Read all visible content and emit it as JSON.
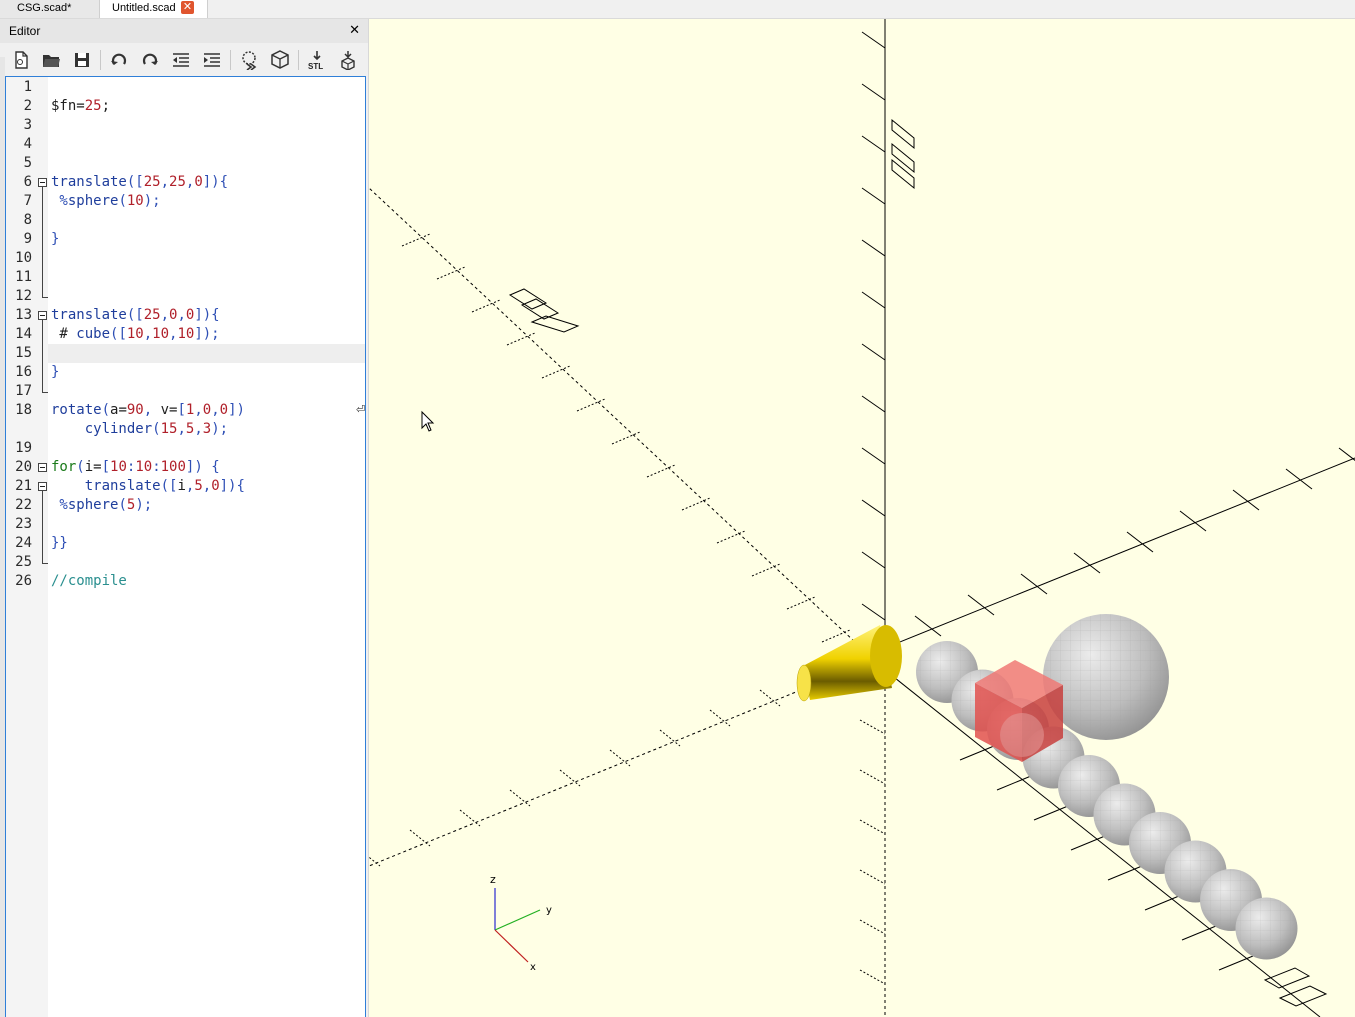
{
  "tabs": [
    {
      "label": "CSG.scad*",
      "active": false
    },
    {
      "label": "Untitled.scad",
      "active": true,
      "close_glyph": "✕"
    }
  ],
  "editor": {
    "title": "Editor",
    "close_glyph": "✕",
    "toolbar": [
      {
        "name": "new-file-icon"
      },
      {
        "name": "open-file-icon"
      },
      {
        "name": "save-icon"
      },
      {
        "name": "undo-icon"
      },
      {
        "name": "redo-icon"
      },
      {
        "name": "unindent-icon"
      },
      {
        "name": "indent-icon"
      },
      {
        "name": "preview-icon"
      },
      {
        "name": "render-icon"
      },
      {
        "name": "export-stl-icon",
        "label": "STL"
      },
      {
        "name": "send-to-3d-print-icon"
      }
    ],
    "wrap_glyph": "⏎",
    "lines": [
      {
        "n": "1",
        "tokens": []
      },
      {
        "n": "2",
        "tokens": [
          [
            "$fn=",
            "plain"
          ],
          [
            "25",
            "num"
          ],
          [
            ";",
            "plain"
          ]
        ]
      },
      {
        "n": "3",
        "tokens": []
      },
      {
        "n": "4",
        "tokens": []
      },
      {
        "n": "5",
        "tokens": []
      },
      {
        "n": "6",
        "tokens": [
          [
            "translate",
            "kw"
          ],
          [
            "([",
            "op"
          ],
          [
            "25",
            "num"
          ],
          [
            ",",
            "op"
          ],
          [
            "25",
            "num"
          ],
          [
            ",",
            "op"
          ],
          [
            "0",
            "num"
          ],
          [
            "]){",
            "op"
          ]
        ]
      },
      {
        "n": "7",
        "tokens": [
          [
            " %",
            "op"
          ],
          [
            "sphere",
            "kw"
          ],
          [
            "(",
            "op"
          ],
          [
            "10",
            "num"
          ],
          [
            ");",
            "op"
          ]
        ]
      },
      {
        "n": "8",
        "tokens": []
      },
      {
        "n": "9",
        "tokens": [
          [
            "}",
            "op"
          ]
        ]
      },
      {
        "n": "10",
        "tokens": []
      },
      {
        "n": "11",
        "tokens": []
      },
      {
        "n": "12",
        "tokens": []
      },
      {
        "n": "13",
        "tokens": [
          [
            "translate",
            "kw"
          ],
          [
            "([",
            "op"
          ],
          [
            "25",
            "num"
          ],
          [
            ",",
            "op"
          ],
          [
            "0",
            "num"
          ],
          [
            ",",
            "op"
          ],
          [
            "0",
            "num"
          ],
          [
            "]){",
            "op"
          ]
        ]
      },
      {
        "n": "14",
        "tokens": [
          [
            " # ",
            "plain"
          ],
          [
            "cube",
            "kw"
          ],
          [
            "([",
            "op"
          ],
          [
            "10",
            "num"
          ],
          [
            ",",
            "op"
          ],
          [
            "10",
            "num"
          ],
          [
            ",",
            "op"
          ],
          [
            "10",
            "num"
          ],
          [
            "]);",
            "op"
          ]
        ]
      },
      {
        "n": "15",
        "tokens": []
      },
      {
        "n": "16",
        "tokens": [
          [
            "}",
            "op"
          ]
        ]
      },
      {
        "n": "17",
        "tokens": []
      },
      {
        "n": "18",
        "tokens": [
          [
            "rotate",
            "kw"
          ],
          [
            "(",
            "op"
          ],
          [
            "a=",
            "plain"
          ],
          [
            "90",
            "num"
          ],
          [
            ", ",
            "op"
          ],
          [
            "v=",
            "plain"
          ],
          [
            "[",
            "op"
          ],
          [
            "1",
            "num"
          ],
          [
            ",",
            "op"
          ],
          [
            "0",
            "num"
          ],
          [
            ",",
            "op"
          ],
          [
            "0",
            "num"
          ],
          [
            "])",
            "op"
          ]
        ]
      },
      {
        "n": "",
        "tokens": [
          [
            "    ",
            "plain"
          ],
          [
            "cylinder",
            "kw"
          ],
          [
            "(",
            "op"
          ],
          [
            "15",
            "num"
          ],
          [
            ",",
            "op"
          ],
          [
            "5",
            "num"
          ],
          [
            ",",
            "op"
          ],
          [
            "3",
            "num"
          ],
          [
            ");",
            "op"
          ]
        ]
      },
      {
        "n": "19",
        "tokens": []
      },
      {
        "n": "20",
        "tokens": [
          [
            "for",
            "kw2"
          ],
          [
            "(",
            "op"
          ],
          [
            "i=",
            "plain"
          ],
          [
            "[",
            "op"
          ],
          [
            "10",
            "num"
          ],
          [
            ":",
            "op"
          ],
          [
            "10",
            "num"
          ],
          [
            ":",
            "op"
          ],
          [
            "100",
            "num"
          ],
          [
            "]) {",
            "op"
          ]
        ]
      },
      {
        "n": "21",
        "tokens": [
          [
            "    ",
            "plain"
          ],
          [
            "translate",
            "kw"
          ],
          [
            "([",
            "op"
          ],
          [
            "i",
            "plain"
          ],
          [
            ",",
            "op"
          ],
          [
            "5",
            "num"
          ],
          [
            ",",
            "op"
          ],
          [
            "0",
            "num"
          ],
          [
            "]){",
            "op"
          ]
        ]
      },
      {
        "n": "22",
        "tokens": [
          [
            " %",
            "op"
          ],
          [
            "sphere",
            "kw"
          ],
          [
            "(",
            "op"
          ],
          [
            "5",
            "num"
          ],
          [
            ");",
            "op"
          ]
        ]
      },
      {
        "n": "23",
        "tokens": []
      },
      {
        "n": "24",
        "tokens": [
          [
            "}}",
            "op"
          ]
        ]
      },
      {
        "n": "25",
        "tokens": []
      },
      {
        "n": "26",
        "tokens": [
          [
            "//compile",
            "comment"
          ]
        ]
      }
    ]
  },
  "viewport": {
    "axis_labels": {
      "x": "x",
      "y": "y",
      "z": "z"
    },
    "colors": {
      "background": "#ffffe5",
      "cylinder": "#f5d800",
      "highlight_cube": "#e8524f",
      "background_spheres": "#bfbfbf"
    }
  },
  "colors": {
    "kw": "#1f3e9c",
    "kw2": "#1a7a1a",
    "num": "#b0202a",
    "op": "#2e4fb5",
    "plain": "#202020",
    "comment": "#2a8f8f"
  }
}
